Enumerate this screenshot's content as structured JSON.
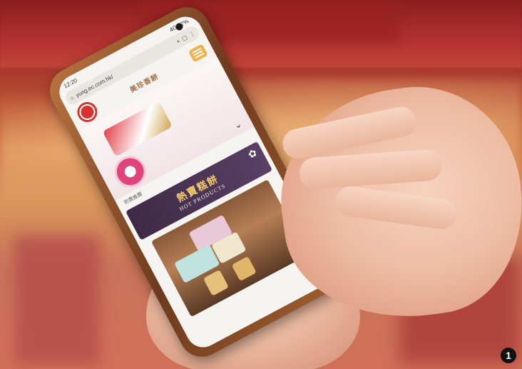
{
  "phone": {
    "status_time": "12:20",
    "status_right": "4G 97%",
    "url": "yung.ec.com.hk/",
    "site_logo_text": "美珍香餅",
    "section_label": "熱賣推薦",
    "banner_title": "熱賣糕餅",
    "banner_subtitle": "HOT PRODUCTS"
  },
  "badge": {
    "number": "1"
  }
}
